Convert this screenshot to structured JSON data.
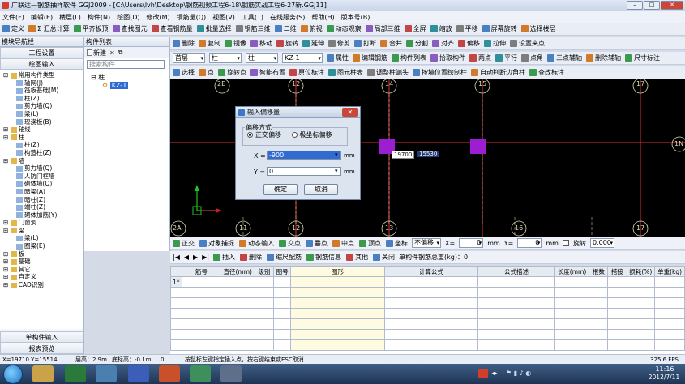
{
  "window": {
    "title": "广联达—钢筋抽样软件 GGJ2009 - [C:\\Users\\lvh\\Desktop\\钢筋视频工程6-18\\钢筋实战工程6-27新.GGJ11]"
  },
  "menu": [
    "文件(F)",
    "编辑(E)",
    "楼层(L)",
    "构件(N)",
    "绘图(D)",
    "修改(M)",
    "钢筋量(Q)",
    "视图(V)",
    "工具(T)",
    "在线服务(S)",
    "帮助(H)",
    "版本号(B)"
  ],
  "toolbar1": [
    "定义",
    "Σ 汇总计算",
    "平齐板顶",
    "查找图元",
    "查看钢筋量",
    "批量选择",
    "钢筋三维",
    "二维",
    "俯视",
    "动态观察",
    "局部三维",
    "全屏",
    "缩放",
    "平移",
    "屏幕旋转",
    "选择楼层"
  ],
  "toolbar2": [
    "删除",
    "复制",
    "镜像",
    "移动",
    "旋转",
    "延伸",
    "修剪",
    "打断",
    "合并",
    "分割",
    "对齐",
    "偏移",
    "拉伸",
    "设置夹点"
  ],
  "toolbar3": {
    "floor": "首层",
    "type1": "柱",
    "type2": "柱",
    "name": "KZ-1",
    "buttons": [
      "属性",
      "编辑钢筋",
      "构件列表",
      "拾取构件",
      "两点",
      "平行",
      "点角",
      "三点辅轴",
      "删除辅轴",
      "尺寸标注"
    ]
  },
  "toolbar4": [
    "选择",
    "点",
    "旋转点",
    "智能布置",
    "原位标注",
    "图元柱表",
    "调整柱端头",
    "按墙位置绘制柱",
    "自动判断边角柱",
    "查改标注"
  ],
  "left_panel": {
    "title": "模块导航栏",
    "nav_buttons": [
      "工程设置",
      "绘图输入"
    ],
    "tree": [
      {
        "label": "常用构件类型",
        "level": 0
      },
      {
        "label": "轴网(J)",
        "level": 1
      },
      {
        "label": "筏板基础(M)",
        "level": 1
      },
      {
        "label": "柱(Z)",
        "level": 1
      },
      {
        "label": "剪力墙(Q)",
        "level": 1
      },
      {
        "label": "梁(L)",
        "level": 1
      },
      {
        "label": "现浇板(B)",
        "level": 1
      },
      {
        "label": "轴线",
        "level": 0
      },
      {
        "label": "柱",
        "level": 0
      },
      {
        "label": "柱(Z)",
        "level": 1
      },
      {
        "label": "构造柱(Z)",
        "level": 1
      },
      {
        "label": "墙",
        "level": 0
      },
      {
        "label": "剪力墙(Q)",
        "level": 1
      },
      {
        "label": "人防门框墙",
        "level": 1
      },
      {
        "label": "砌体墙(Q)",
        "level": 1
      },
      {
        "label": "暗梁(A)",
        "level": 1
      },
      {
        "label": "暗柱(Z)",
        "level": 1
      },
      {
        "label": "端柱(Z)",
        "level": 1
      },
      {
        "label": "砌体加筋(Y)",
        "level": 1
      },
      {
        "label": "门窗洞",
        "level": 0
      },
      {
        "label": "梁",
        "level": 0
      },
      {
        "label": "梁(L)",
        "level": 1
      },
      {
        "label": "圈梁(E)",
        "level": 1
      },
      {
        "label": "板",
        "level": 0
      },
      {
        "label": "基础",
        "level": 0
      },
      {
        "label": "其它",
        "level": 0
      },
      {
        "label": "自定义",
        "level": 0
      },
      {
        "label": "CAD识别",
        "level": 0
      }
    ],
    "bottom_buttons": [
      "单构件输入",
      "报表预览"
    ]
  },
  "component_list": {
    "title": "构件列表",
    "new_label": "新建",
    "search_placeholder": "搜索构件...",
    "root": "柱",
    "item": "KZ-1"
  },
  "canvas": {
    "axis_top": [
      "2E",
      "12",
      "14",
      "15",
      "17"
    ],
    "axis_bottom": [
      "2A",
      "11",
      "12",
      "13",
      "16",
      "17"
    ],
    "axis_right": "1N",
    "coord_label": "19700",
    "coord_value": "15530",
    "accent_color": "#9b1fd1"
  },
  "dialog": {
    "title": "输入偏移量",
    "group": "偏移方式",
    "option1": "正交偏移",
    "option2": "极坐标偏移",
    "x_label": "X =",
    "x_value": "-900",
    "y_label": "Y =",
    "y_value": "0",
    "unit": "mm",
    "ok": "确定",
    "cancel": "取消"
  },
  "snap_bar": {
    "items": [
      "正交",
      "对象捕捉",
      "动态输入",
      "交点",
      "垂点",
      "中点",
      "顶点",
      "坐标"
    ],
    "mode": "不偏移",
    "x_label": "X=",
    "x_value": "0",
    "unit": "mm",
    "y_label": "Y=",
    "y_value": "0",
    "rotate_label": "旋转",
    "rotate_value": "0.000"
  },
  "rebar_toolbar": {
    "items": [
      "插入",
      "删除",
      "缩尺配筋",
      "钢筋信息",
      "其他",
      "关闭"
    ],
    "total": "单构件钢筋总重(kg)：0"
  },
  "rebar_table": {
    "headers": [
      "筋号",
      "直径(mm)",
      "级别",
      "图号",
      "图形",
      "计算公式",
      "公式描述",
      "长度(mm)",
      "根数",
      "搭接",
      "损耗(%)",
      "单重(kg)"
    ],
    "row_index": "1*"
  },
  "status": {
    "coords": "X=19710 Y=15514",
    "floor_height": "层高：2.9m",
    "bottom_height": "底标高：-0.1m",
    "value": "0",
    "hint": "按鼠标左键指定插入点，按右键结束或ESC取消",
    "fps": "325.6 FPS"
  },
  "clock": {
    "time": "11:16",
    "date": "2012/7/11"
  }
}
